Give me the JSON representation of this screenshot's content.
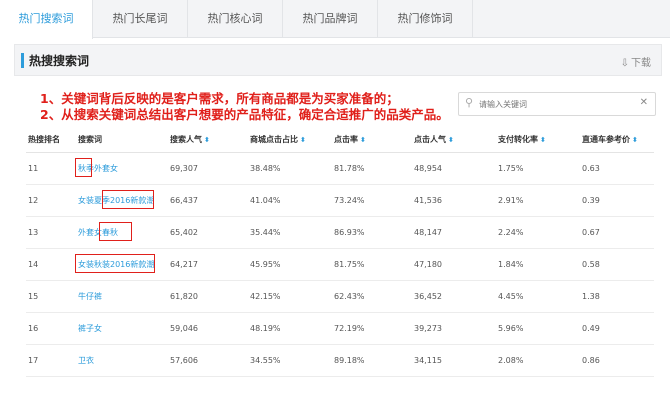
{
  "tabs": [
    {
      "label": "热门搜索词",
      "active": true
    },
    {
      "label": "热门长尾词",
      "active": false
    },
    {
      "label": "热门核心词",
      "active": false
    },
    {
      "label": "热门品牌词",
      "active": false
    },
    {
      "label": "热门修饰词",
      "active": false
    }
  ],
  "panel": {
    "title": "热搜搜索词",
    "download_label": "下载",
    "download_icon": "download-icon"
  },
  "annotations": {
    "line1": "1、关键词背后反映的是客户需求，所有商品都是为买家准备的；",
    "line2": "2、从搜索关键词总结出客户想要的产品特征，确定合适推广的品类产品。",
    "color": "#e0201b"
  },
  "search": {
    "placeholder": "请输入关键词",
    "icon": "search-icon",
    "clear_icon": "close-icon"
  },
  "table": {
    "columns": [
      "热搜排名",
      "搜索词",
      "搜索人气",
      "商城点击占比",
      "点击率",
      "点击人气",
      "支付转化率",
      "直通车参考价"
    ],
    "sortable": [
      false,
      false,
      true,
      true,
      true,
      true,
      true,
      true
    ],
    "rows": [
      [
        "11",
        "秋季外套女",
        "69,307",
        "38.48%",
        "81.78%",
        "48,954",
        "1.75%",
        "0.63"
      ],
      [
        "12",
        "女装夏季2016新款潮",
        "66,437",
        "41.04%",
        "73.24%",
        "41,536",
        "2.91%",
        "0.39"
      ],
      [
        "13",
        "外套女春秋",
        "65,402",
        "35.44%",
        "86.93%",
        "48,147",
        "2.24%",
        "0.67"
      ],
      [
        "14",
        "女装秋装2016新款潮",
        "64,217",
        "45.95%",
        "81.75%",
        "47,180",
        "1.84%",
        "0.58"
      ],
      [
        "15",
        "牛仔裤",
        "61,820",
        "42.15%",
        "62.43%",
        "36,452",
        "4.45%",
        "1.38"
      ],
      [
        "16",
        "裤子女",
        "59,046",
        "48.19%",
        "72.19%",
        "39,273",
        "5.96%",
        "0.49"
      ],
      [
        "17",
        "卫衣",
        "57,606",
        "34.55%",
        "89.18%",
        "34,115",
        "2.08%",
        "0.86"
      ]
    ]
  },
  "colors": {
    "accent": "#2d9cdb",
    "highlight": "#e0201b"
  }
}
